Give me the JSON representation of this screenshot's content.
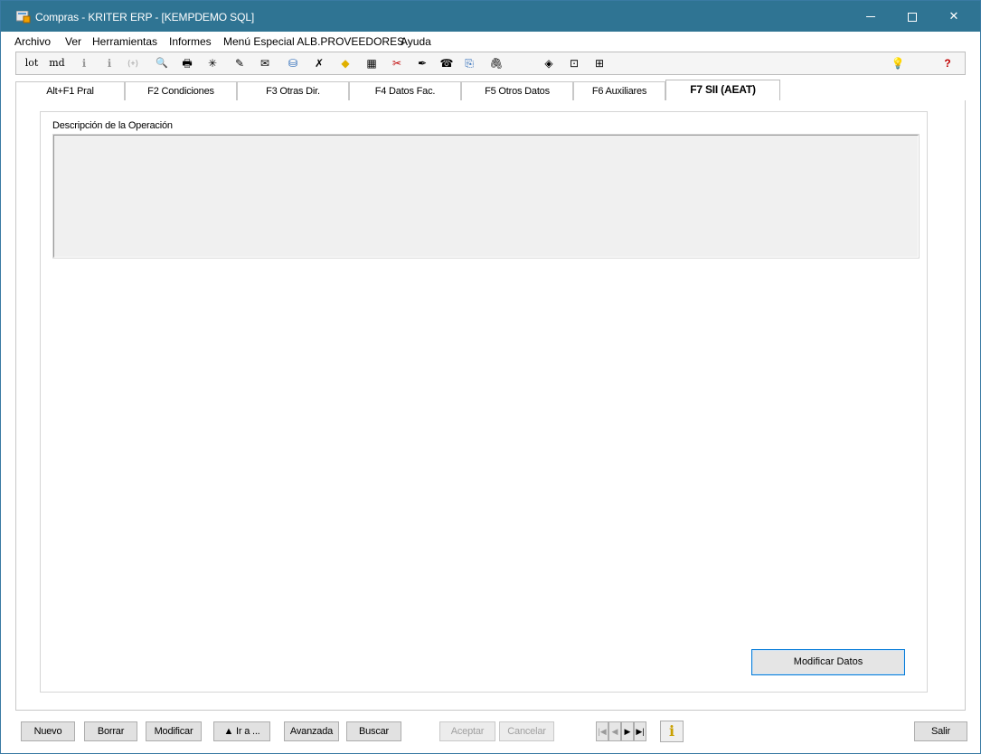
{
  "window": {
    "title": "Compras - KRITER ERP - [KEMPDEMO SQL]",
    "controls": {
      "minimize": "minimize-icon",
      "maximize": "maximize-icon",
      "close_label": "✕"
    }
  },
  "menu": {
    "items": [
      "Archivo",
      "Ver",
      "Herramientas",
      "Informes",
      "Menú Especial ALB.PROVEEDORES",
      "Ayuda"
    ]
  },
  "toolbar": {
    "lot_label": "lot",
    "md_label": "md",
    "icons": {
      "info1": "ℹ",
      "info2": "ℹ",
      "nav": "⟨+⟩",
      "preview": "🔍",
      "print": "🖶",
      "asterisk": "✳",
      "tool1": "✎",
      "tool2": "✉",
      "tool3": "⛁",
      "tool4": "✗",
      "tool5": "◆",
      "tool6": "▦",
      "tool7": "✂",
      "tool8": "✒",
      "tool9": "☎",
      "clip1": "⎘",
      "clip2": "🖇",
      "eye": "◈",
      "search_doc": "⊡",
      "grid": "⊞",
      "bulb": "💡",
      "help": "?"
    }
  },
  "tabs": [
    {
      "label": "Alt+F1 Pral"
    },
    {
      "label": "F2 Condiciones"
    },
    {
      "label": "F3 Otras Dir."
    },
    {
      "label": "F4 Datos Fac."
    },
    {
      "label": "F5 Otros Datos"
    },
    {
      "label": "F6 Auxiliares"
    },
    {
      "label": "F7 SII (AEAT)"
    }
  ],
  "active_tab": "F7 SII (AEAT)",
  "content": {
    "description_label": "Descripción de la Operación",
    "description_value": "",
    "modify_button": "Modificar Datos"
  },
  "bottom": {
    "nuevo": "Nuevo",
    "borrar": "Borrar",
    "modificar": "Modificar",
    "ira": "▲ Ir a ...",
    "avanzada": "Avanzada",
    "buscar": "Buscar",
    "aceptar": "Aceptar",
    "cancelar": "Cancelar",
    "nav_first": "|◀",
    "nav_prev": "◀",
    "nav_next": "▶",
    "nav_last": "▶|",
    "info": "i",
    "salir": "Salir"
  },
  "colors": {
    "titlebar": "#2f7493",
    "focus_border": "#0078d7"
  }
}
